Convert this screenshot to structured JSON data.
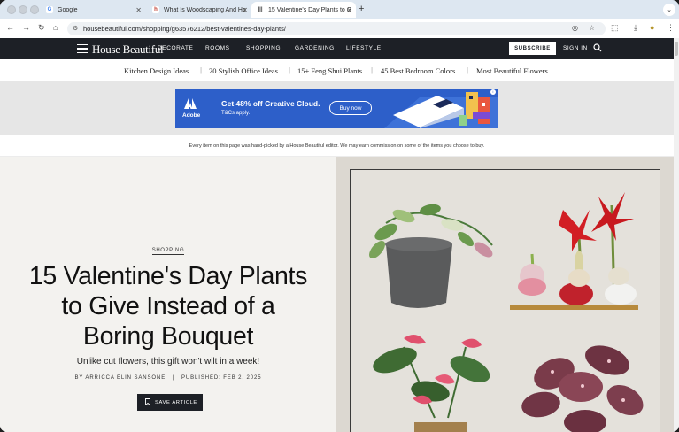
{
  "browser": {
    "tabs": [
      {
        "title": "Google",
        "active": false
      },
      {
        "title": "What Is Woodscaping And Ho",
        "active": false
      },
      {
        "title": "15 Valentine's Day Plants to G",
        "active": true
      }
    ],
    "url": "housebeautiful.com/shopping/g63576212/best-valentines-day-plants/"
  },
  "site": {
    "logo": "House Beautiful",
    "nav": [
      "DECORATE",
      "ROOMS",
      "SHOPPING",
      "GARDENING",
      "LIFESTYLE"
    ],
    "subscribe_label": "SUBSCRIBE",
    "signin_label": "SIGN IN",
    "trending": [
      "Kitchen Design Ideas",
      "20 Stylish Office Ideas",
      "15+ Feng Shui Plants",
      "45 Best Bedroom Colors",
      "Most Beautiful Flowers"
    ]
  },
  "ad": {
    "brand": "Adobe",
    "headline": "Get 48% off Creative Cloud.",
    "terms": "T&Cs apply.",
    "cta": "Buy now"
  },
  "disclaimer": "Every item on this page was hand-picked by a House Beautiful editor. We may earn commission on some of the items you choose to buy.",
  "article": {
    "kicker": "SHOPPING",
    "headline": "15 Valentine's Day Plants to Give Instead of a Boring Bouquet",
    "dek": "Unlike cut flowers, this gift won't wilt in a week!",
    "byline": "BY ARRICCA ELIN SANSONE",
    "published": "PUBLISHED: FEB 2, 2025",
    "save_label": "SAVE ARTICLE"
  },
  "colors": {
    "nav_bg": "#1d2026",
    "ad_blue": "#2d5fc9",
    "hero_left_bg": "#f3f2ef",
    "hero_right_bg": "#dcd8d1"
  }
}
